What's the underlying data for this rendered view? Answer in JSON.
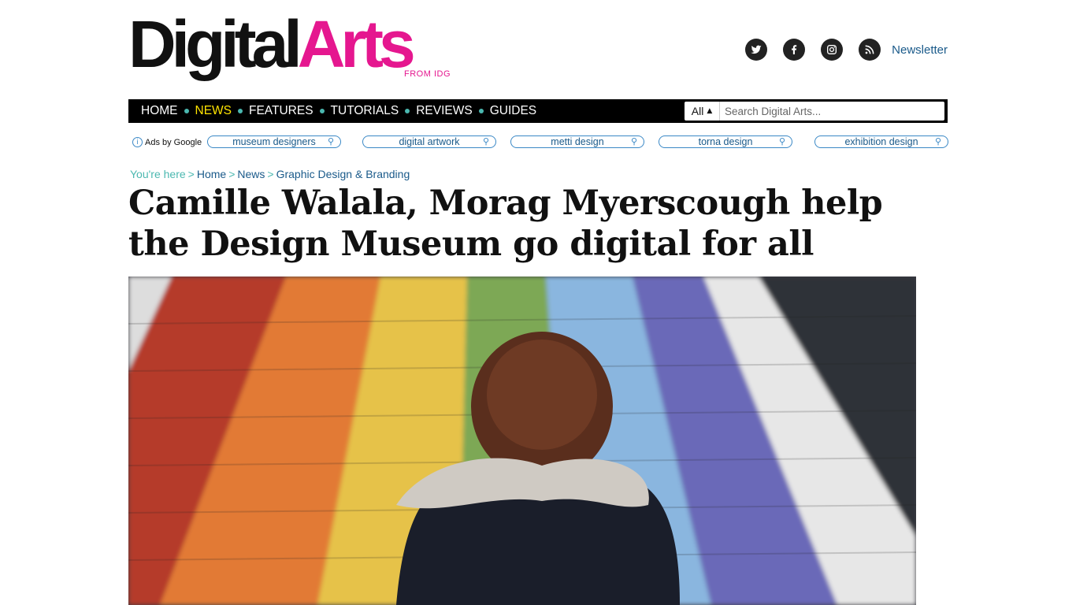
{
  "logo": {
    "part1": "Digital",
    "part2": "Arts",
    "sub": "FROM IDG"
  },
  "social": {
    "newsletter": "Newsletter",
    "icons": [
      "twitter-icon",
      "facebook-icon",
      "instagram-icon",
      "rss-icon"
    ]
  },
  "nav": {
    "items": [
      "HOME",
      "NEWS",
      "FEATURES",
      "TUTORIALS",
      "REVIEWS",
      "GUIDES"
    ],
    "search_scope": "All",
    "search_placeholder": "Search Digital Arts..."
  },
  "ads": {
    "by": "Ads by Google",
    "pills": [
      "museum designers",
      "digital artwork",
      "metti design",
      "torna design",
      "exhibition design"
    ]
  },
  "breadcrumb": {
    "prefix": "You're here",
    "items": [
      "Home",
      "News",
      "Graphic Design & Branding"
    ]
  },
  "article": {
    "title": "Camille Walala, Morag Myerscough help the Design Museum go digital for all"
  },
  "colors": {
    "accent": "#e5178f",
    "nav_active": "#ffe400",
    "link": "#1a5a8a",
    "teal": "#4bb8b0"
  }
}
